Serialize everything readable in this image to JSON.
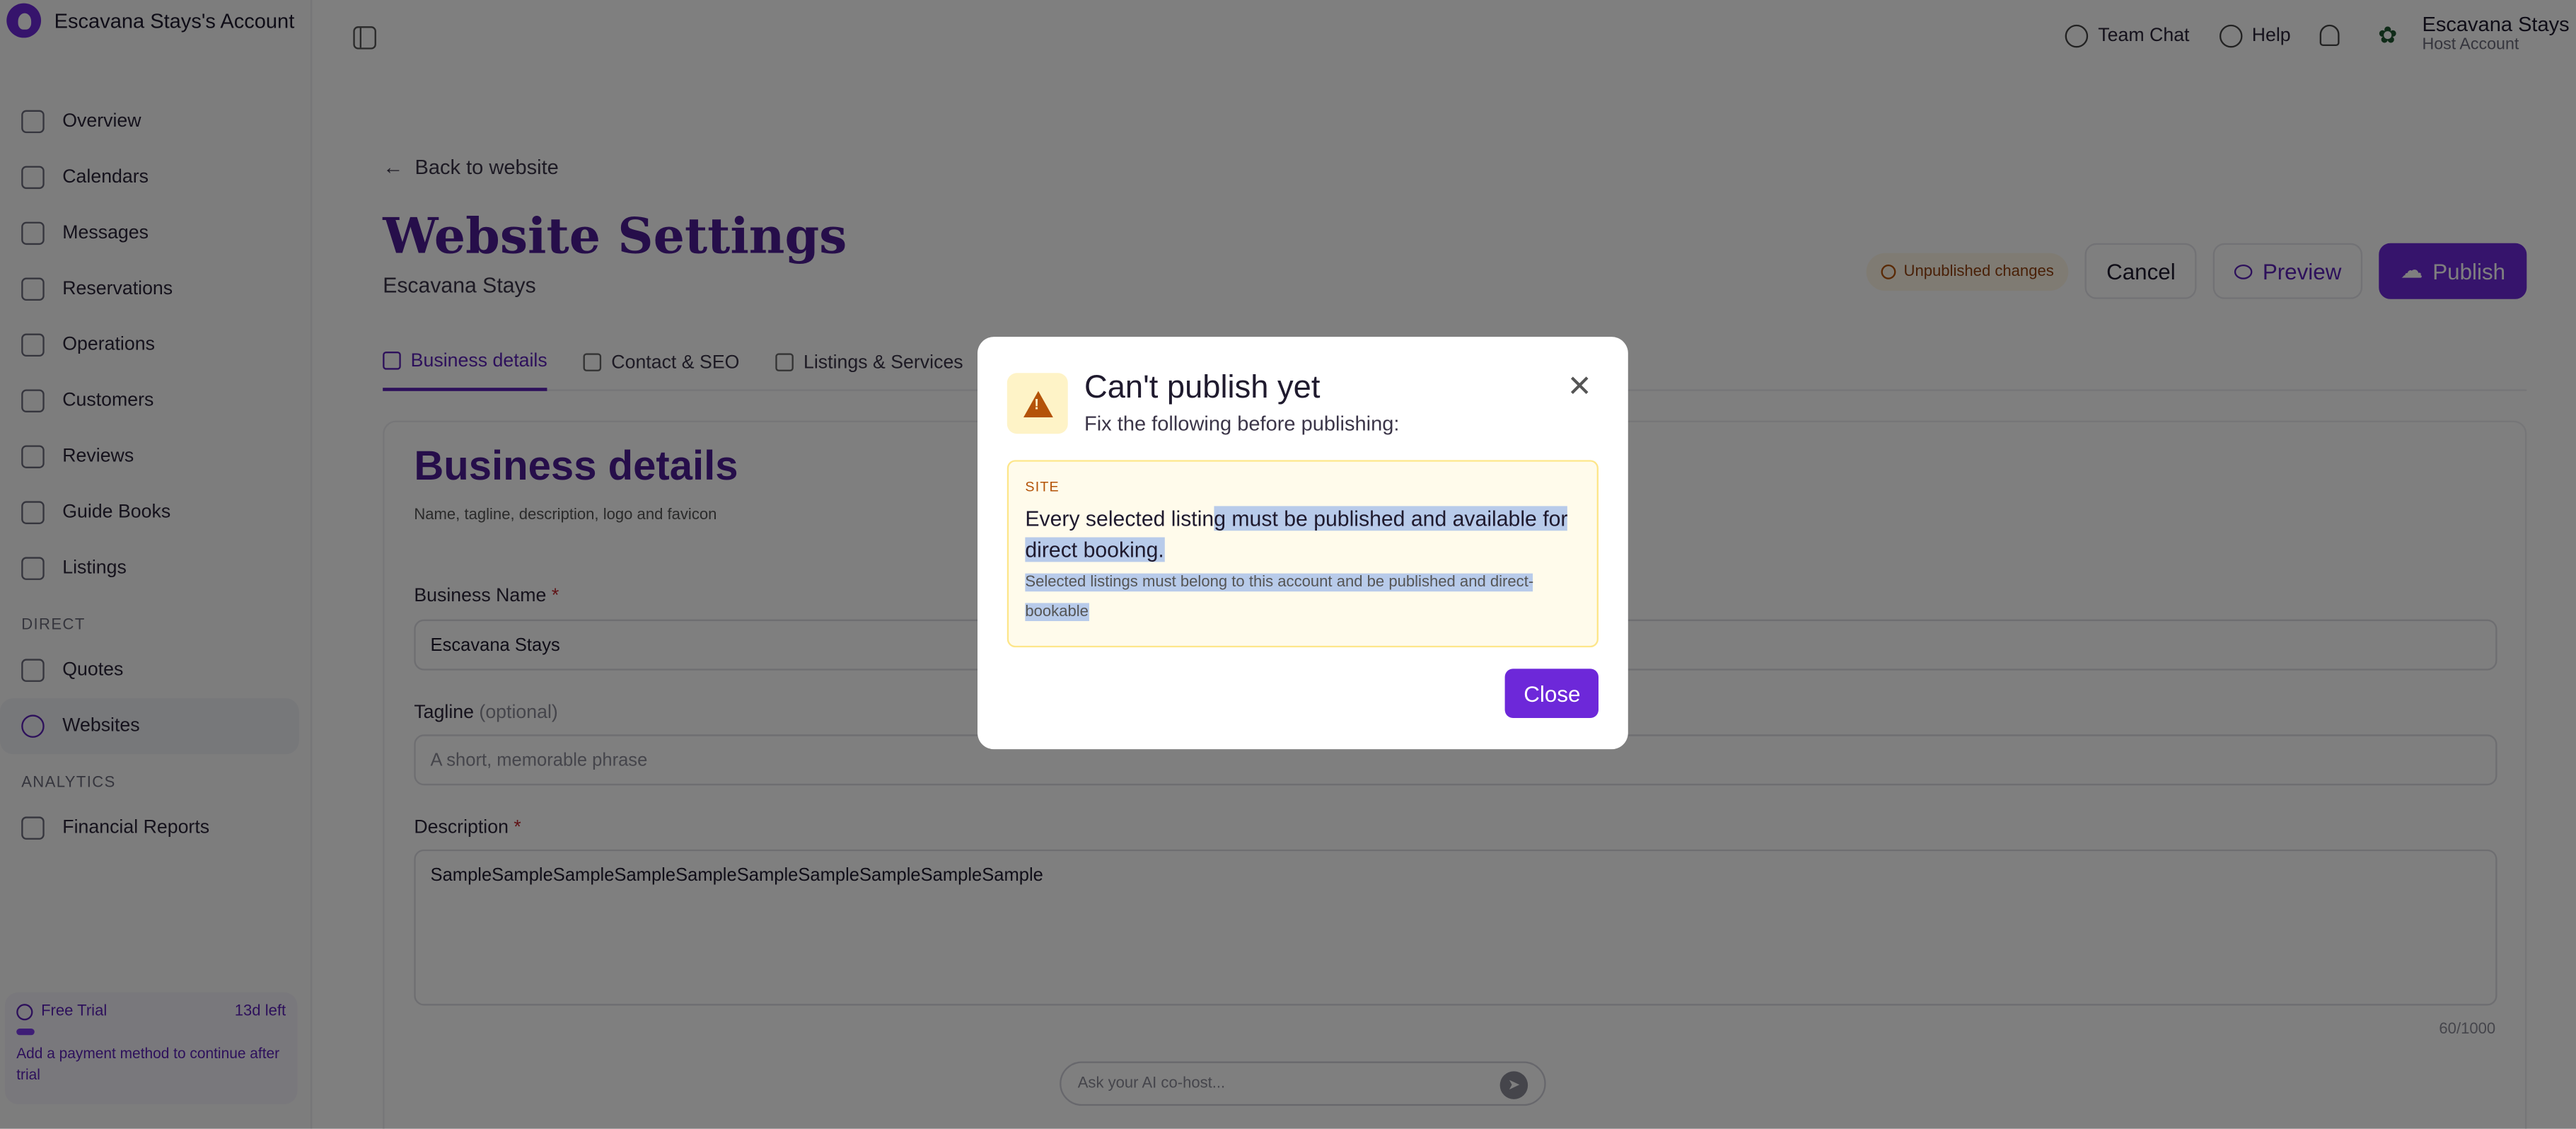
{
  "account": {
    "title": "Escavana Stays's Account"
  },
  "sidebar": {
    "items": [
      {
        "label": "Overview"
      },
      {
        "label": "Calendars"
      },
      {
        "label": "Messages"
      },
      {
        "label": "Reservations"
      },
      {
        "label": "Operations"
      },
      {
        "label": "Customers"
      },
      {
        "label": "Reviews"
      },
      {
        "label": "Guide Books"
      },
      {
        "label": "Listings"
      }
    ],
    "section_direct": "DIRECT",
    "direct_items": [
      {
        "label": "Quotes"
      },
      {
        "label": "Websites"
      }
    ],
    "section_analytics": "ANALYTICS",
    "analytics_items": [
      {
        "label": "Financial Reports"
      }
    ],
    "trial": {
      "label": "Free Trial",
      "remaining": "13d left",
      "note": "Add a payment method to continue after trial",
      "progress": 0.07
    }
  },
  "topbar": {
    "team_chat": "Team Chat",
    "help": "Help",
    "host_name": "Escavana Stays",
    "host_role": "Host Account"
  },
  "page": {
    "back_label": "Back to website",
    "title": "Website Settings",
    "subtitle": "Escavana Stays",
    "status_badge": "Unpublished changes",
    "cancel": "Cancel",
    "preview": "Preview",
    "publish": "Publish",
    "tabs": [
      {
        "label": "Business details"
      },
      {
        "label": "Contact & SEO"
      },
      {
        "label": "Listings & Services"
      }
    ]
  },
  "card": {
    "title": "Business details",
    "subtitle": "Name, tagline, description, logo and favicon",
    "business_name_label": "Business Name",
    "required_mark": "*",
    "business_name_value": "Escavana Stays",
    "tagline_label": "Tagline",
    "tagline_optional": "(optional)",
    "tagline_placeholder": "A short, memorable phrase",
    "description_label": "Description",
    "description_value": "SampleSampleSampleSampleSampleSampleSampleSampleSampleSample",
    "description_counter": "60/1000"
  },
  "ai": {
    "placeholder": "Ask your AI co-host..."
  },
  "modal": {
    "title": "Can't publish yet",
    "subtitle": "Fix the following before publishing:",
    "issue_tag": "SITE",
    "issue_main_pre": "Every selected listin",
    "issue_main_sel": "g must be published and available for direct booking.",
    "issue_detail": "Selected listings must belong to this account and be published and direct-bookable",
    "close_label": "Close"
  },
  "colors": {
    "brand": "#6d28d9",
    "title": "#4c1d95",
    "warning": "#b45309"
  }
}
